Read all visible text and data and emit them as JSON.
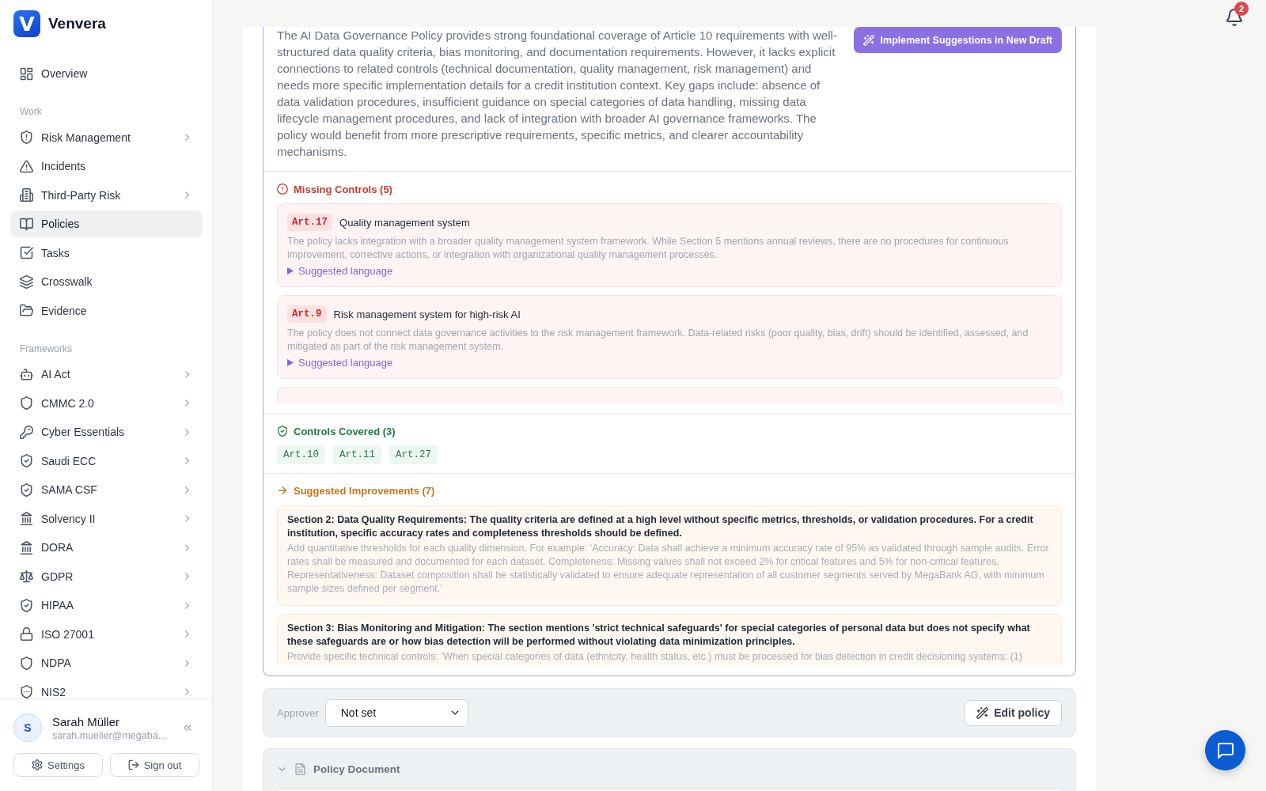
{
  "sidebar": {
    "brand": {
      "mark": "V",
      "name": "Venvera"
    },
    "sections": [
      {
        "items": [
          {
            "label": "Overview",
            "selected": false
          }
        ]
      },
      {
        "heading": "Work",
        "items": [
          {
            "label": "Risk Management",
            "selected": false,
            "expanded": false
          },
          {
            "label": "Incidents",
            "selected": false
          },
          {
            "label": "Third-Party Risk",
            "selected": false,
            "expanded": false
          },
          {
            "label": "Policies",
            "selected": true
          },
          {
            "label": "Tasks",
            "selected": false
          },
          {
            "label": "Crosswalk",
            "selected": false
          },
          {
            "label": "Evidence",
            "selected": false
          }
        ]
      },
      {
        "heading": "Frameworks",
        "items": [
          {
            "label": "AI Act",
            "selected": false,
            "expanded": false
          },
          {
            "label": "CMMC 2.0",
            "selected": false,
            "expanded": false
          },
          {
            "label": "Cyber Essentials",
            "selected": false,
            "expanded": false
          },
          {
            "label": "Saudi ECC",
            "selected": false,
            "expanded": false
          },
          {
            "label": "SAMA CSF",
            "selected": false,
            "expanded": false
          },
          {
            "label": "Solvency II",
            "selected": false,
            "expanded": false
          },
          {
            "label": "DORA",
            "selected": false,
            "expanded": false
          },
          {
            "label": "GDPR",
            "selected": false,
            "expanded": false
          },
          {
            "label": "HIPAA",
            "selected": false,
            "expanded": false
          },
          {
            "label": "ISO 27001",
            "selected": false,
            "expanded": false
          },
          {
            "label": "NDPA",
            "selected": false,
            "expanded": false
          },
          {
            "label": "NIS2",
            "selected": false,
            "expanded": false
          }
        ]
      }
    ],
    "user": {
      "initial": "S",
      "name": "Sarah Müller",
      "email": "sarah.mueller@megaba..."
    },
    "buttons": [
      {
        "kind": "settings",
        "label": "Settings"
      },
      {
        "kind": "sign_out",
        "label": "Sign out"
      }
    ]
  },
  "header": {
    "notifications": {
      "count": "2"
    }
  },
  "analysis": {
    "summary": "The AI Data Governance Policy provides strong foundational coverage of Article 10 requirements with well-structured data quality criteria, bias monitoring, and documentation requirements. However, it lacks explicit connections to related controls (technical documentation, quality management, risk management) and needs more specific implementation details for a credit institution context. Key gaps include: absence of data validation procedures, insufficient guidance on special categories of data handling, missing data lifecycle management procedures, and lack of integration with broader AI governance frameworks. The policy would benefit from more prescriptive requirements, specific metrics, and clearer accountability mechanisms.",
    "implement_button": "Implement Suggestions in New Draft",
    "missing_controls": {
      "title": "Missing Controls (5)",
      "items": [
        {
          "kind": "full",
          "article": "Art.17",
          "title": "Quality management system",
          "description": "The policy lacks integration with a broader quality management system framework. While Section 5 mentions annual reviews, there are no procedures for continuous improvement, corrective actions, or integration with organizational quality management processes.",
          "link": "Suggested language"
        },
        {
          "kind": "full",
          "article": "Art.9",
          "title": "Risk management system for high-risk AI",
          "description": "The policy does not connect data governance activities to the risk management framework. Data-related risks (poor quality, bias, drift) should be identified, assessed, and mitigated as part of the risk management system.",
          "link": "Suggested language"
        },
        {
          "kind": "clipped"
        }
      ]
    },
    "controls_covered": {
      "title": "Controls Covered (3)",
      "articles": [
        "Art.10",
        "Art.11",
        "Art.27"
      ]
    },
    "suggested_improvements": {
      "title": "Suggested Improvements (7)",
      "items": [
        {
          "title": "Section 2: Data Quality Requirements: The quality criteria are defined at a high level without specific metrics, thresholds, or validation procedures. For a credit institution, specific accuracy rates and completeness thresholds should be defined.",
          "description": "Add quantitative thresholds for each quality dimension. For example: 'Accuracy: Data shall achieve a minimum accuracy rate of 95% as validated through sample audits. Error rates shall be measured and documented for each dataset. Completeness: Missing values shall not exceed 2% for critical features and 5% for non-critical features. Representativeness: Dataset composition shall be statistically validated to ensure adequate representation of all customer segments served by MegaBank AG, with minimum sample sizes defined per segment.'"
        },
        {
          "title": "Section 3: Bias Monitoring and Mitigation: The section mentions 'strict technical safeguards' for special categories of personal data but does not specify what these safeguards are or how bias detection will be performed without violating data minimization principles.",
          "description": "Provide specific technical controls: 'When special categories of data (ethnicity, health status, etc.) must be processed for bias detection in credit decisioning systems: (1)"
        }
      ]
    }
  },
  "approver_bar": {
    "label": "Approver",
    "value": "Not set",
    "edit_button": "Edit policy"
  },
  "policy_document": {
    "title": "Policy Document",
    "expanded": true
  }
}
